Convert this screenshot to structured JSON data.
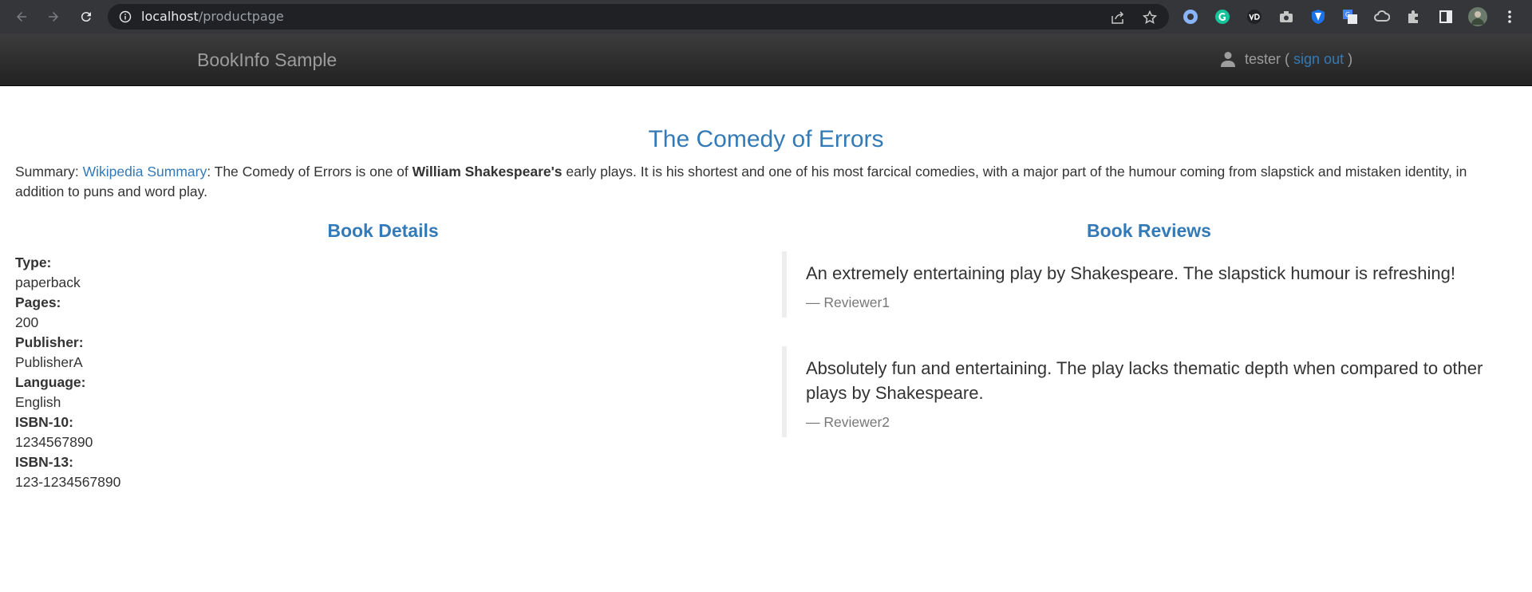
{
  "browser": {
    "url_host": "localhost",
    "url_path": "/productpage"
  },
  "navbar": {
    "brand": "BookInfo Sample",
    "user_name": "tester (",
    "sign_out": "sign out",
    "close_paren": ")"
  },
  "book": {
    "title": "The Comedy of Errors",
    "summary_label": "Summary:",
    "summary_link": "Wikipedia Summary",
    "summary_text_1": ": The Comedy of Errors is one of",
    "summary_author": "William Shakespeare's",
    "summary_text_2": "early plays. It is his shortest and one of his most farcical comedies, with a major part of the humour coming from slapstick and mistaken identity, in addition to puns and word play."
  },
  "details": {
    "heading": "Book Details",
    "fields": [
      {
        "label": "Type:",
        "value": "paperback"
      },
      {
        "label": "Pages:",
        "value": "200"
      },
      {
        "label": "Publisher:",
        "value": "PublisherA"
      },
      {
        "label": "Language:",
        "value": "English"
      },
      {
        "label": "ISBN-10:",
        "value": "1234567890"
      },
      {
        "label": "ISBN-13:",
        "value": "123-1234567890"
      }
    ]
  },
  "reviews": {
    "heading": "Book Reviews",
    "items": [
      {
        "text": "An extremely entertaining play by Shakespeare. The slapstick humour is refreshing!",
        "reviewer": "— Reviewer1"
      },
      {
        "text": "Absolutely fun and entertaining. The play lacks thematic depth when compared to other plays by Shakespeare.",
        "reviewer": "— Reviewer2"
      }
    ]
  }
}
